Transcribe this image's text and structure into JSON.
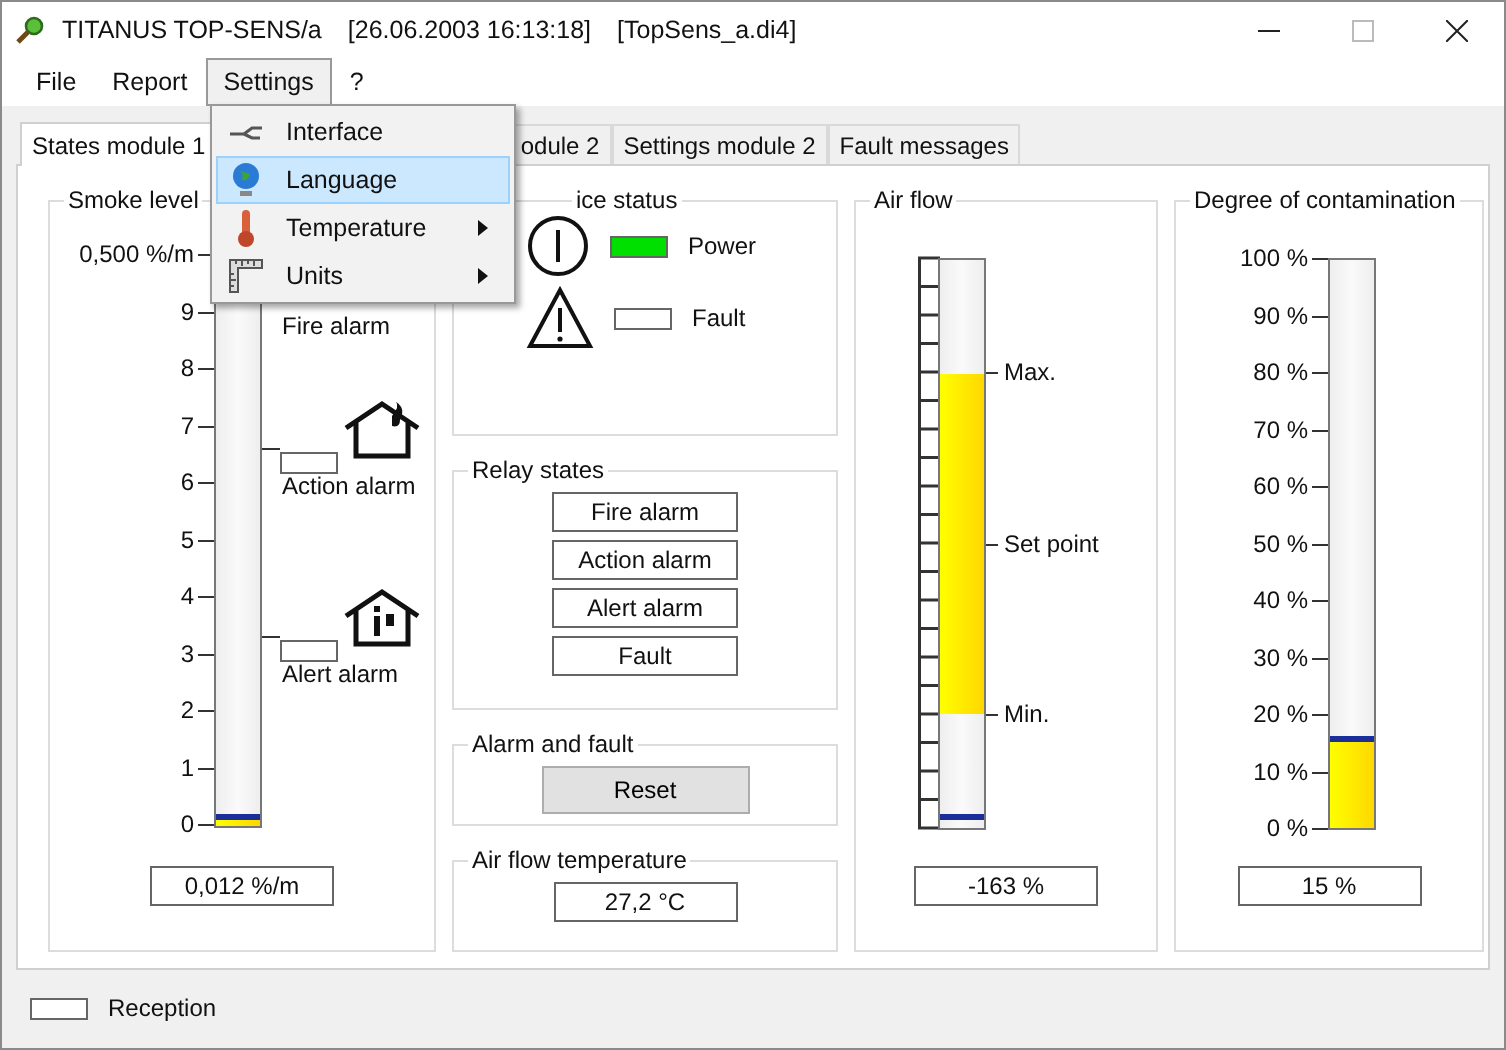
{
  "window": {
    "title": "TITANUS TOP-SENS/a",
    "timestamp": "[26.06.2003 16:13:18]",
    "file": "[TopSens_a.di4]"
  },
  "menu": [
    {
      "label": "File",
      "selected": false
    },
    {
      "label": "Report",
      "selected": false
    },
    {
      "label": "Settings",
      "selected": true
    },
    {
      "label": "?",
      "selected": false
    }
  ],
  "dropdown": [
    {
      "label": "Interface",
      "kind": "interface",
      "selected": false,
      "submenu": false
    },
    {
      "label": "Language",
      "kind": "language",
      "selected": true,
      "submenu": false
    },
    {
      "label": "Temperature",
      "kind": "temperature",
      "selected": false,
      "submenu": true
    },
    {
      "label": "Units",
      "kind": "units",
      "selected": false,
      "submenu": true
    }
  ],
  "tabs": [
    {
      "label": "States module 1",
      "selected": true
    },
    {
      "label": "odule 2",
      "selected": false
    },
    {
      "label": "Settings module 2",
      "selected": false
    },
    {
      "label": "Fault messages",
      "selected": false
    }
  ],
  "smoke": {
    "title": "Smoke level",
    "scale": [
      "0,500 %/m",
      "9",
      "8",
      "7",
      "6",
      "5",
      "4",
      "3",
      "2",
      "1",
      "0"
    ],
    "level": 0.012,
    "reading": "0,012 %/m",
    "alarms": [
      {
        "label": "Fire alarm",
        "kind": "fire",
        "level": 0.94
      },
      {
        "label": "Action alarm",
        "kind": "action",
        "level": 0.66,
        "on": false
      },
      {
        "label": "Alert alarm",
        "kind": "alert",
        "level": 0.33,
        "on": false
      }
    ]
  },
  "device_status": {
    "title": "ice status",
    "items": [
      {
        "label": "Power",
        "kind": "power",
        "on": true
      },
      {
        "label": "Fault",
        "kind": "fault",
        "on": false
      }
    ]
  },
  "relay_states": {
    "title": "Relay states",
    "relays": [
      {
        "label": "Fire alarm",
        "on": false
      },
      {
        "label": "Action alarm",
        "on": false
      },
      {
        "label": "Alert alarm",
        "on": false
      },
      {
        "label": "Fault",
        "on": false
      }
    ]
  },
  "alarm_and_fault": {
    "title": "Alarm and fault",
    "button": "Reset"
  },
  "air_flow_temperature": {
    "title": "Air flow temperature",
    "reading": "27,2 °C"
  },
  "air_flow": {
    "title": "Air flow",
    "level": 0.015,
    "reading": "-163 %",
    "markers": [
      {
        "label": "Max.",
        "level": 0.8
      },
      {
        "label": "Set point",
        "level": 0.5
      },
      {
        "label": "Min.",
        "level": 0.2
      }
    ]
  },
  "contamination": {
    "title": "Degree of contamination",
    "scale": [
      "100 %",
      "90 %",
      "80 %",
      "70 %",
      "60 %",
      "50 %",
      "40 %",
      "30 %",
      "20 %",
      "10 %",
      "0 %"
    ],
    "level": 0.15,
    "reading": "15 %"
  },
  "status_bar": {
    "label": "Reception",
    "on": false
  }
}
